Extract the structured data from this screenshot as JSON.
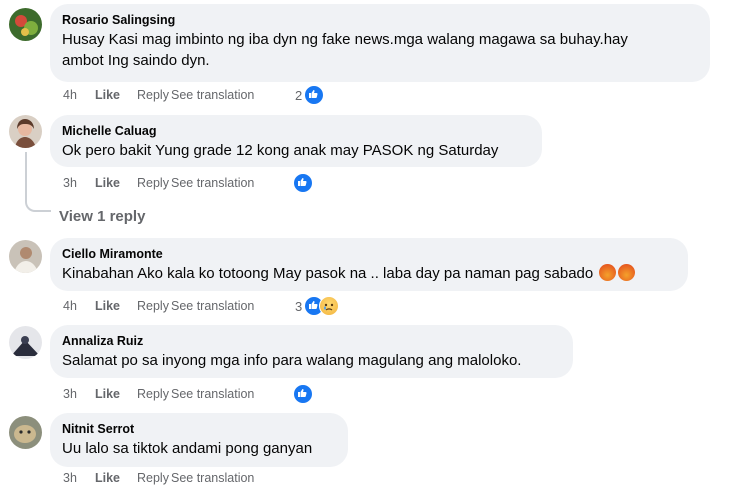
{
  "comments": [
    {
      "author": "Rosario Salingsing",
      "text": "Husay Kasi mag imbinto ng iba dyn ng fake news.mga walang magawa sa buhay.hay\nambot Ing saindo dyn.",
      "time": "4h",
      "like": "Like",
      "reply": "Reply",
      "translate": "See translation",
      "reaction_count": "2",
      "reactions": [
        "like-icon"
      ]
    },
    {
      "author": "Michelle Caluag",
      "text": "Ok pero bakit Yung grade 12 kong anak may PASOK ng Saturday",
      "time": "3h",
      "like": "Like",
      "reply": "Reply",
      "translate": "See translation",
      "reaction_count": "",
      "reactions": [
        "like-icon"
      ]
    },
    {
      "author": "Ciello Miramonte",
      "text": "Kinabahan Ako kala ko totoong May pasok na .. laba day pa naman pag sabado",
      "time": "4h",
      "like": "Like",
      "reply": "Reply",
      "translate": "See translation",
      "reaction_count": "3",
      "reactions": [
        "like-icon",
        "sad-icon"
      ]
    },
    {
      "author": "Annaliza Ruiz",
      "text": "Salamat po sa inyong mga info para walang magulang ang maloloko.",
      "time": "3h",
      "like": "Like",
      "reply": "Reply",
      "translate": "See translation",
      "reaction_count": "",
      "reactions": [
        "like-icon"
      ]
    },
    {
      "author": "Nitnit Serrot",
      "text": "Uu lalo sa tiktok andami pong ganyan",
      "time": "3h",
      "like": "Like",
      "reply": "Reply",
      "translate": "See translation",
      "reaction_count": "",
      "reactions": []
    }
  ],
  "view_replies": "View 1 reply",
  "colors": {
    "bubble": "#f0f2f5",
    "meta": "#65676b",
    "like_blue": "#1877f2"
  }
}
